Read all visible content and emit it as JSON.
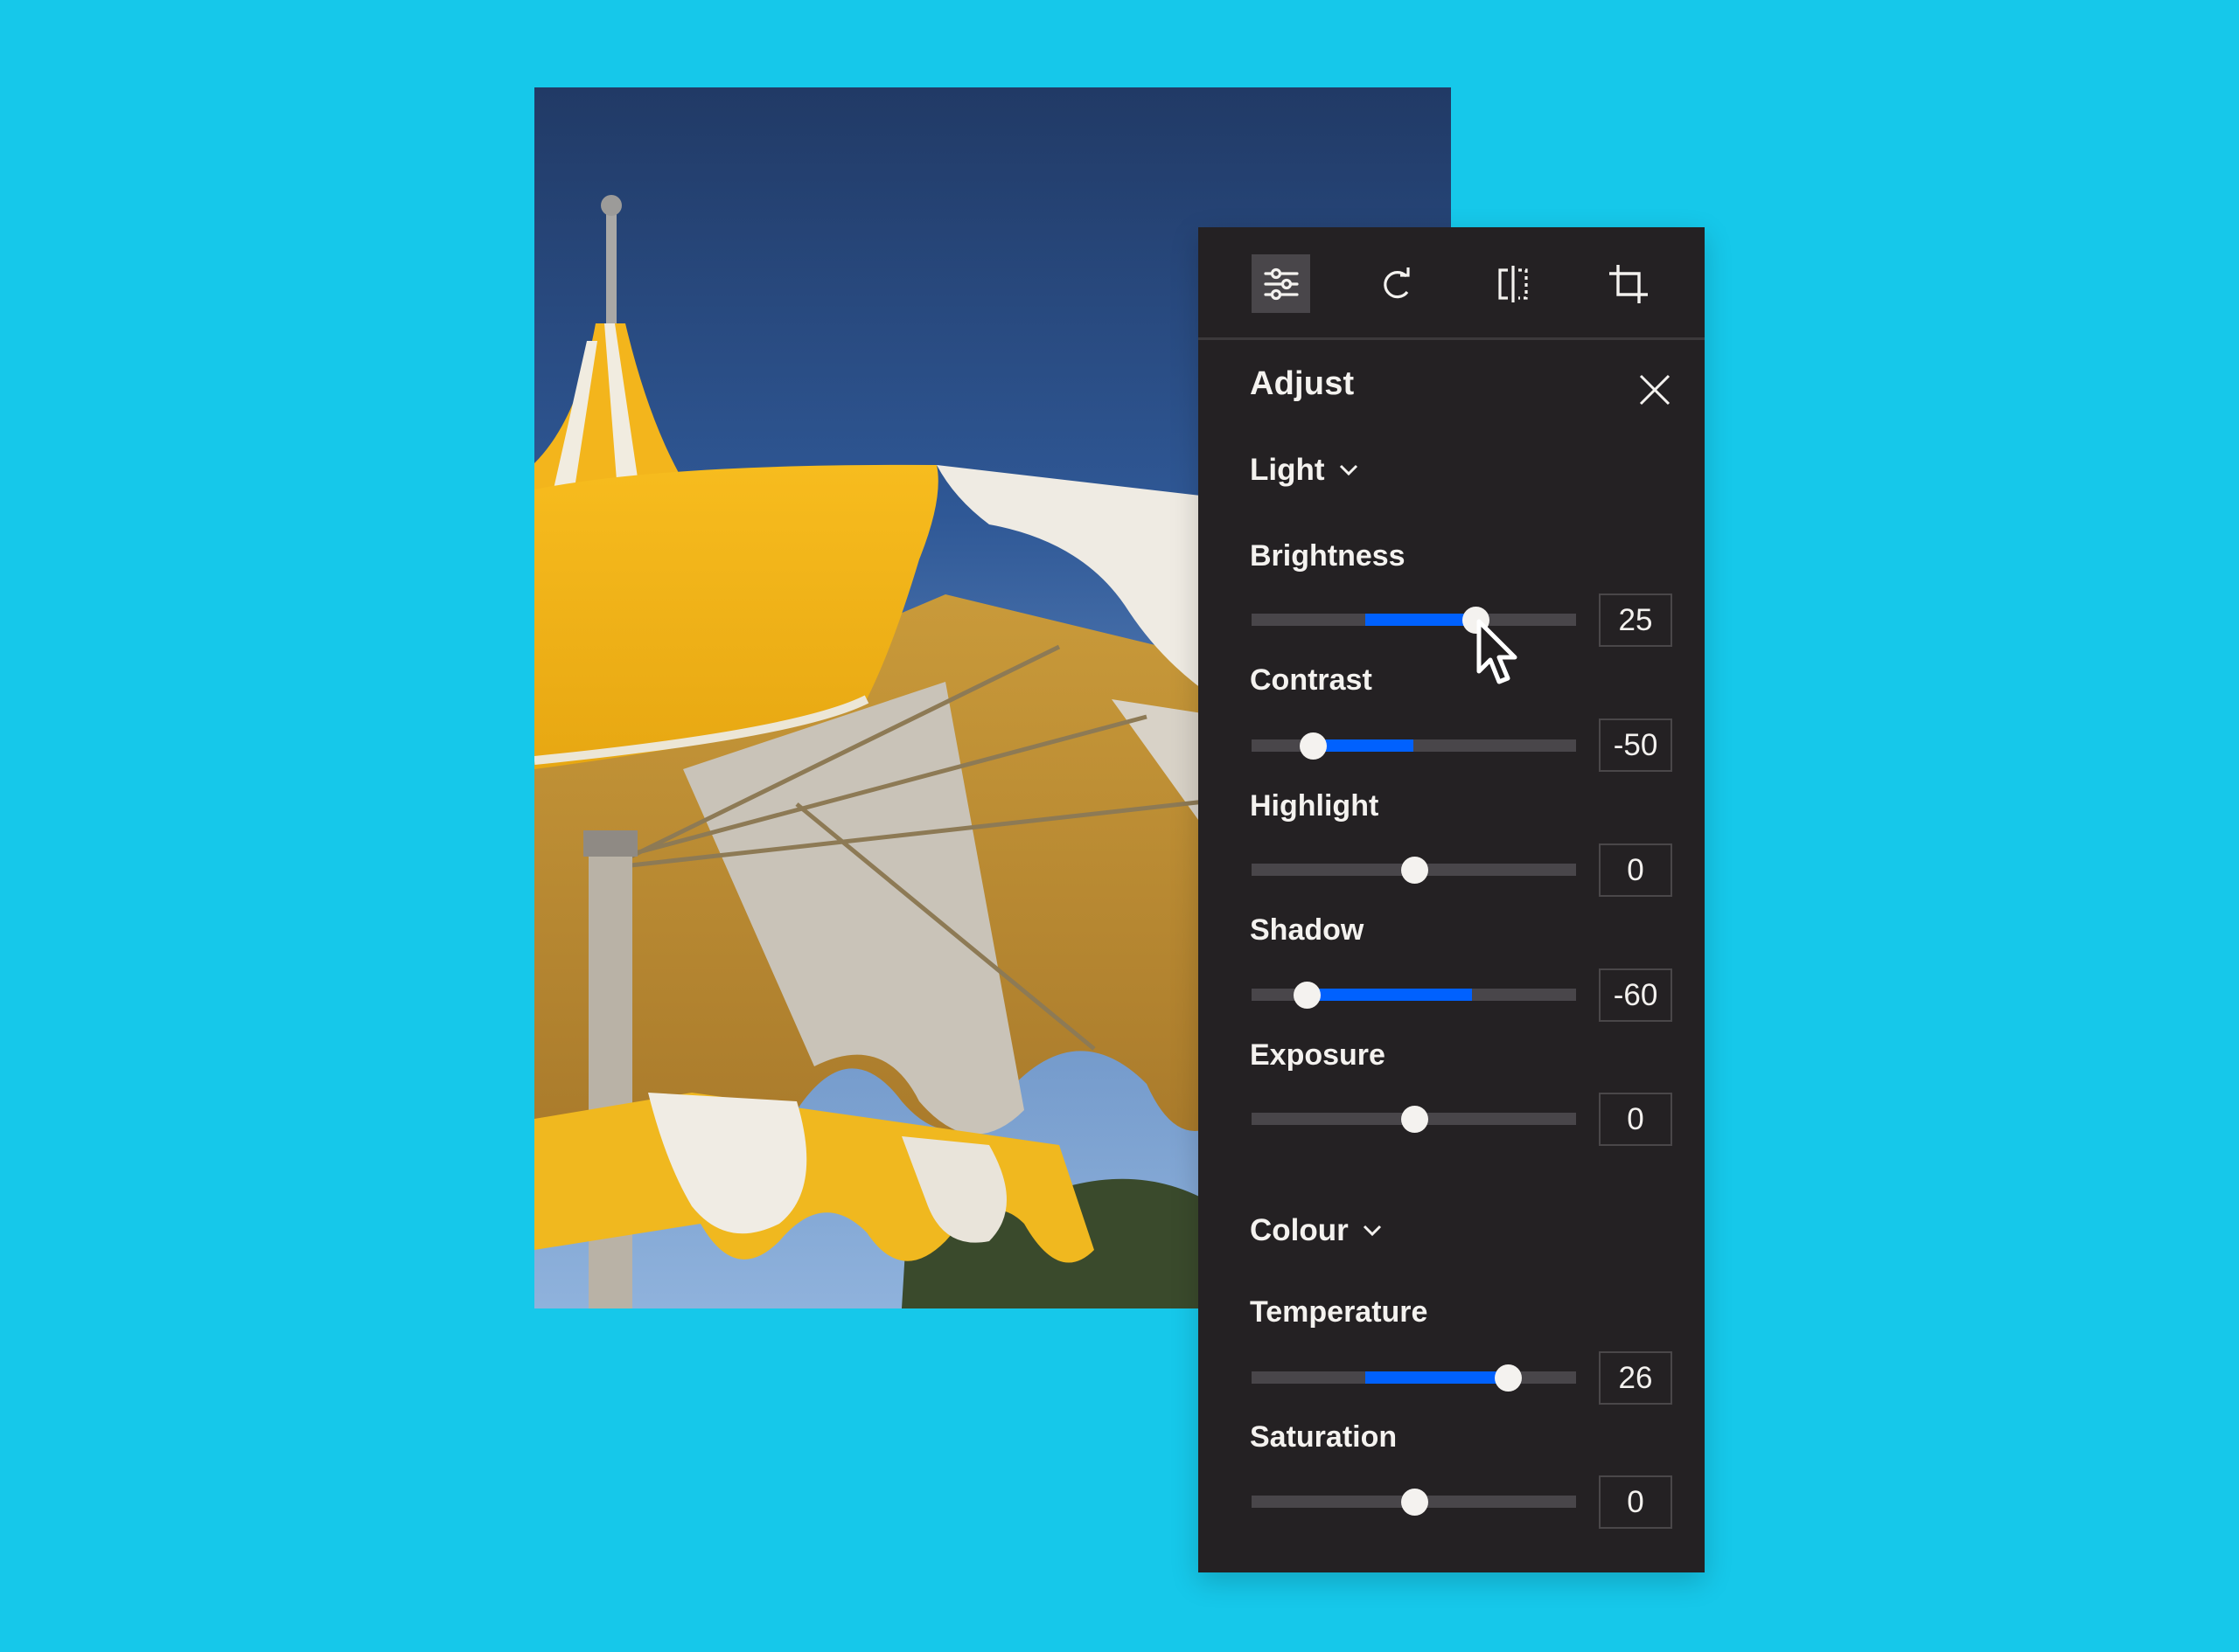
{
  "toolbar": {
    "tools": [
      {
        "name": "adjust",
        "icon": "sliders-icon",
        "active": true
      },
      {
        "name": "rotate",
        "icon": "rotate-icon",
        "active": false
      },
      {
        "name": "flip",
        "icon": "flip-icon",
        "active": false
      },
      {
        "name": "crop",
        "icon": "crop-icon",
        "active": false
      }
    ]
  },
  "panel": {
    "title": "Adjust",
    "close_icon": "close-icon",
    "sections": [
      {
        "label": "Light",
        "controls": [
          {
            "label": "Brightness",
            "value": "25",
            "thumb": 0.69,
            "fill_from": 0.35,
            "fill_to": 0.69
          },
          {
            "label": "Contrast",
            "value": "-50",
            "thumb": 0.19,
            "fill_from": 0.19,
            "fill_to": 0.5
          },
          {
            "label": "Highlight",
            "value": "0",
            "thumb": 0.5,
            "fill_from": 0.5,
            "fill_to": 0.5
          },
          {
            "label": "Shadow",
            "value": "-60",
            "thumb": 0.17,
            "fill_from": 0.17,
            "fill_to": 0.68
          },
          {
            "label": "Exposure",
            "value": "0",
            "thumb": 0.5,
            "fill_from": 0.5,
            "fill_to": 0.5
          }
        ]
      },
      {
        "label": "Colour",
        "controls": [
          {
            "label": "Temperature",
            "value": "26",
            "thumb": 0.79,
            "fill_from": 0.35,
            "fill_to": 0.79
          },
          {
            "label": "Saturation",
            "value": "0",
            "thumb": 0.5,
            "fill_from": 0.5,
            "fill_to": 0.5
          }
        ]
      }
    ]
  },
  "colors": {
    "background": "#16c8ea",
    "panel": "#242123",
    "accent": "#0061fe",
    "track": "#49464a",
    "text": "#f4f2ef"
  },
  "photo": {
    "description": "yellow and white striped patio umbrella against blue sky"
  }
}
